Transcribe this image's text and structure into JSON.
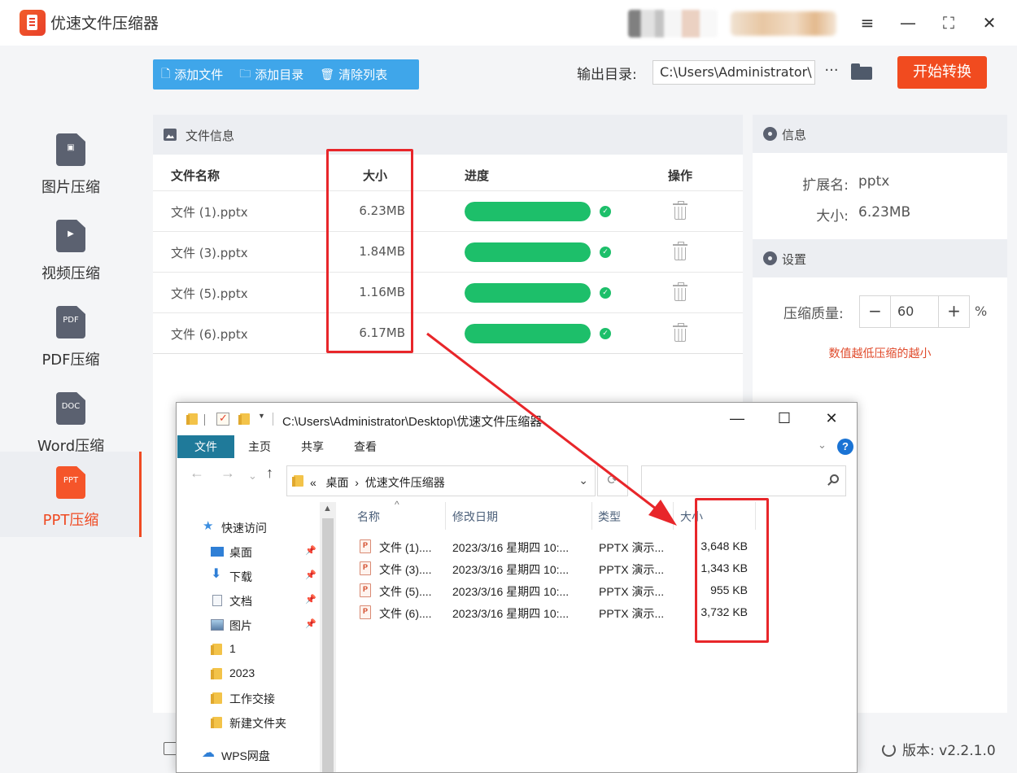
{
  "app": {
    "title": "优速文件压缩器",
    "window_controls": {
      "menu": "≡",
      "minimize": "—",
      "maximize": "⛶",
      "close": "✕"
    }
  },
  "sidebar": {
    "items": [
      {
        "label": "图片压缩",
        "glyph": "▣",
        "icon": "image-file-icon",
        "active": false
      },
      {
        "label": "视频压缩",
        "glyph": "▶",
        "icon": "video-file-icon",
        "active": false
      },
      {
        "label": "PDF压缩",
        "glyph": "PDF",
        "icon": "pdf-file-icon",
        "active": false
      },
      {
        "label": "Word压缩",
        "glyph": "DOC",
        "icon": "word-file-icon",
        "active": false
      },
      {
        "label": "PPT压缩",
        "glyph": "PPT",
        "icon": "ppt-file-icon",
        "active": true
      }
    ],
    "accent_color": "#ef4a23"
  },
  "toolbar": {
    "add_file": "添加文件",
    "add_dir": "添加目录",
    "clear_list": "清除列表",
    "output_label": "输出目录:",
    "output_path": "C:\\Users\\Administrator\\",
    "more": "···",
    "start": "开始转换",
    "start_color": "#f14b1f",
    "button_group_color": "#3fa6ea"
  },
  "file_panel": {
    "title": "文件信息",
    "columns": {
      "name": "文件名称",
      "size": "大小",
      "progress": "进度",
      "action": "操作"
    },
    "rows": [
      {
        "name": "文件 (1).pptx",
        "size": "6.23MB",
        "progress": 1.0,
        "done": true
      },
      {
        "name": "文件 (3).pptx",
        "size": "1.84MB",
        "progress": 1.0,
        "done": true
      },
      {
        "name": "文件 (5).pptx",
        "size": "1.16MB",
        "progress": 1.0,
        "done": true
      },
      {
        "name": "文件 (6).pptx",
        "size": "6.17MB",
        "progress": 1.0,
        "done": true
      }
    ],
    "progress_color": "#1dbf6a"
  },
  "info_panel": {
    "title": "信息",
    "ext_key": "扩展名:",
    "ext_val": "pptx",
    "size_key": "大小:",
    "size_val": "6.23MB"
  },
  "settings_panel": {
    "title": "设置",
    "quality_label": "压缩质量:",
    "quality_value": "60",
    "minus": "−",
    "plus": "+",
    "unit": "%",
    "hint": "数值越低压缩的越小",
    "hint_color": "#e04a2b"
  },
  "footer": {
    "version": "版本: v2.2.1.0"
  },
  "explorer": {
    "path": "C:\\Users\\Administrator\\Desktop\\优速文件压缩器",
    "window_controls": {
      "minimize": "—",
      "maximize": "☐",
      "close": "✕"
    },
    "ribbon": {
      "file": "文件",
      "home": "主页",
      "share": "共享",
      "view": "查看",
      "help": "?"
    },
    "address": {
      "prefix": "«",
      "crumb1": "桌面",
      "sep": "›",
      "crumb2": "优速文件压缩器",
      "dropdown": "⌄"
    },
    "nav": {
      "back": "←",
      "forward": "→",
      "recent": "⌄",
      "up": "↑"
    },
    "tree": [
      {
        "label": "快速访问",
        "icon": "star-icon",
        "pinned": false,
        "indent": 0
      },
      {
        "label": "桌面",
        "icon": "desktop-icon",
        "pinned": true,
        "indent": 1
      },
      {
        "label": "下载",
        "icon": "download-icon",
        "pinned": true,
        "indent": 1
      },
      {
        "label": "文档",
        "icon": "document-icon",
        "pinned": true,
        "indent": 1
      },
      {
        "label": "图片",
        "icon": "pictures-icon",
        "pinned": true,
        "indent": 1
      },
      {
        "label": "1",
        "icon": "folder-icon",
        "pinned": false,
        "indent": 1
      },
      {
        "label": "2023",
        "icon": "folder-icon",
        "pinned": false,
        "indent": 1
      },
      {
        "label": "工作交接",
        "icon": "folder-icon",
        "pinned": false,
        "indent": 1
      },
      {
        "label": "新建文件夹",
        "icon": "folder-icon",
        "pinned": false,
        "indent": 1
      },
      {
        "label": "WPS网盘",
        "icon": "cloud-icon",
        "pinned": false,
        "indent": 0
      }
    ],
    "columns": {
      "name": "名称",
      "date": "修改日期",
      "type": "类型",
      "size": "大小"
    },
    "files": [
      {
        "name": "文件 (1)....",
        "date": "2023/3/16 星期四 10:...",
        "type": "PPTX 演示...",
        "size": "3,648 KB"
      },
      {
        "name": "文件 (3)....",
        "date": "2023/3/16 星期四 10:...",
        "type": "PPTX 演示...",
        "size": "1,343 KB"
      },
      {
        "name": "文件 (5)....",
        "date": "2023/3/16 星期四 10:...",
        "type": "PPTX 演示...",
        "size": "955 KB"
      },
      {
        "name": "文件 (6)....",
        "date": "2023/3/16 星期四 10:...",
        "type": "PPTX 演示...",
        "size": "3,732 KB"
      }
    ]
  },
  "annotation_color": "#e8262a"
}
